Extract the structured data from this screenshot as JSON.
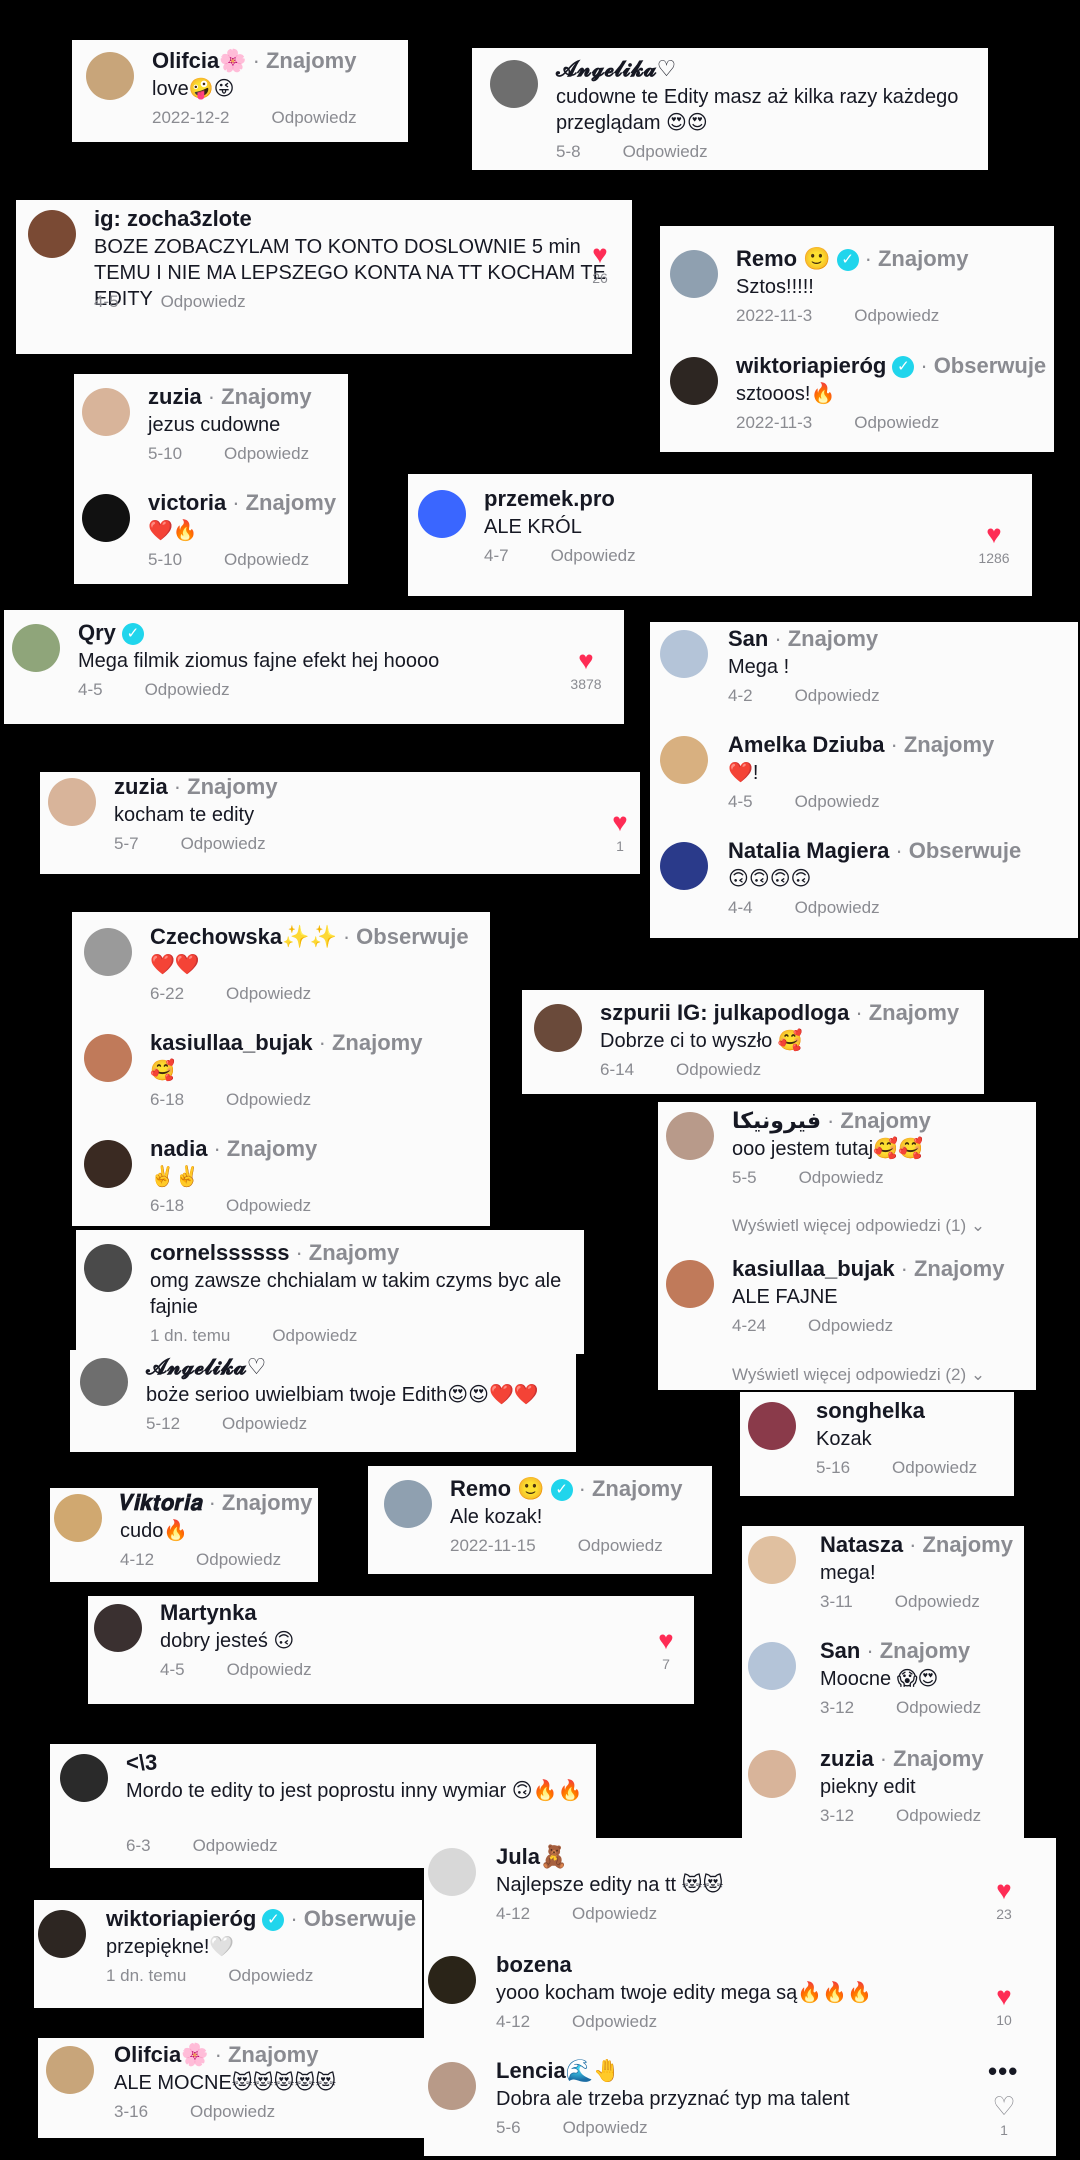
{
  "comments": [
    {
      "id": "c1",
      "user": "Olifcia🌸",
      "rel": "Znajomy",
      "text": "love🤪😜",
      "date": "2022-12-2",
      "reply": "Odpowiedz",
      "av": "#c8a57a"
    },
    {
      "id": "c2",
      "user": "𝓐𝓷𝓰𝓮𝓵𝓲𝓴𝓪♡",
      "rel": "",
      "text": "cudowne te Edity masz aż kilka razy każdego przeglądam 😍😍",
      "date": "5-8",
      "reply": "Odpowiedz",
      "av": "#6e6e6e"
    },
    {
      "id": "c3",
      "user": "ig:  zocha3zlote",
      "rel": "",
      "text": "BOZE ZOBACZYLAM TO KONTO DOSLOWNIE 5 min TEMU I NIE MA LEPSZEGO KONTA NA TT KOCHAM TE EDITY",
      "date": "4-5",
      "reply": "Odpowiedz",
      "av": "#7a4a34",
      "likes": "26"
    },
    {
      "id": "c4",
      "user": "Remo 🙂",
      "rel": "Znajomy",
      "verified": true,
      "text": "Sztos!!!!!",
      "date": "2022-11-3",
      "reply": "Odpowiedz",
      "av": "#8fa0b0"
    },
    {
      "id": "c5",
      "user": "wiktoriapieróg",
      "rel": "Obserwuje",
      "verified": true,
      "text": "sztooos!🔥",
      "date": "2022-11-3",
      "reply": "Odpowiedz",
      "av": "#2d2622"
    },
    {
      "id": "c6",
      "user": "zuzia",
      "rel": "Znajomy",
      "text": "jezus cudowne",
      "date": "5-10",
      "reply": "Odpowiedz",
      "av": "#d8b49a"
    },
    {
      "id": "c7",
      "user": "victoria",
      "rel": "Znajomy",
      "text": "❤️🔥",
      "date": "5-10",
      "reply": "Odpowiedz",
      "av": "#111111"
    },
    {
      "id": "c8",
      "user": "przemek.pro",
      "rel": "",
      "text": "ALE KRÓL",
      "date": "4-7",
      "reply": "Odpowiedz",
      "av": "#3a66ff",
      "likes": "1286"
    },
    {
      "id": "c9",
      "user": "Qry",
      "rel": "",
      "verified": true,
      "text": "Mega filmik ziomus fajne efekt hej hoooo",
      "date": "4-5",
      "reply": "Odpowiedz",
      "av": "#8fa57a",
      "likes": "3878"
    },
    {
      "id": "c10",
      "user": "San",
      "rel": "Znajomy",
      "text": "Mega !",
      "date": "4-2",
      "reply": "Odpowiedz",
      "av": "#b4c4d8"
    },
    {
      "id": "c11",
      "user": "Amelka Dziuba",
      "rel": "Znajomy",
      "text": "❤️!",
      "date": "4-5",
      "reply": "Odpowiedz",
      "av": "#d8b080"
    },
    {
      "id": "c12",
      "user": "Natalia Magiera",
      "rel": "Obserwuje",
      "text": "🙃🙃🙃🙃",
      "date": "4-4",
      "reply": "Odpowiedz",
      "av": "#2a3a8a"
    },
    {
      "id": "c13",
      "user": "zuzia",
      "rel": "Znajomy",
      "text": "kocham te edity",
      "date": "5-7",
      "reply": "Odpowiedz",
      "av": "#d8b49a",
      "likes": "1"
    },
    {
      "id": "c14",
      "user": "Czechowska✨✨",
      "rel": "Obserwuje",
      "text": "❤️❤️",
      "date": "6-22",
      "reply": "Odpowiedz",
      "av": "#9a9a9a"
    },
    {
      "id": "c15",
      "user": "kasiullaa_bujak",
      "rel": "Znajomy",
      "text": "🥰",
      "date": "6-18",
      "reply": "Odpowiedz",
      "av": "#c07a5a"
    },
    {
      "id": "c16",
      "user": "nadia",
      "rel": "Znajomy",
      "text": "✌️✌️",
      "date": "6-18",
      "reply": "Odpowiedz",
      "av": "#3a2a22"
    },
    {
      "id": "c17",
      "user": "szpurii IG: julkapodloga",
      "rel": "Znajomy",
      "text": "Dobrze ci to wyszło 🥰",
      "date": "6-14",
      "reply": "Odpowiedz",
      "av": "#6a4a3a"
    },
    {
      "id": "c18",
      "user": "فيرونيكا",
      "rel": "Znajomy",
      "text": "ooo jestem tutaj🥰🥰",
      "date": "5-5",
      "reply": "Odpowiedz",
      "av": "#b89a8a"
    },
    {
      "id": "c19",
      "user": "kasiullaa_bujak",
      "rel": "Znajomy",
      "text": "ALE FAJNE",
      "date": "4-24",
      "reply": "Odpowiedz",
      "av": "#c07a5a"
    },
    {
      "id": "c20",
      "user": "cornelssssss",
      "rel": "Znajomy",
      "text": "omg zawsze chchialam w takim czyms byc ale fajnie",
      "date": "1 dn. temu",
      "reply": "Odpowiedz",
      "av": "#4a4a4a"
    },
    {
      "id": "c21",
      "user": "𝓐𝓷𝓰𝓮𝓵𝓲𝓴𝓪♡",
      "rel": "",
      "text": "boże serioo uwielbiam twoje Edith😍😍❤️❤️",
      "date": "5-12",
      "reply": "Odpowiedz",
      "av": "#6e6e6e"
    },
    {
      "id": "c22",
      "user": "songhelka",
      "rel": "",
      "text": "Kozak",
      "date": "5-16",
      "reply": "Odpowiedz",
      "av": "#8a3a4a"
    },
    {
      "id": "c23",
      "user": "𝑽𝒊𝒌𝒕𝒐𝒓𝒊𝒂",
      "rel": "Znajomy",
      "text": "cudo🔥",
      "date": "4-12",
      "reply": "Odpowiedz",
      "av": "#d0a870"
    },
    {
      "id": "c24",
      "user": "Remo 🙂",
      "rel": "Znajomy",
      "verified": true,
      "text": "Ale kozak!",
      "date": "2022-11-15",
      "reply": "Odpowiedz",
      "av": "#8fa0b0"
    },
    {
      "id": "c25",
      "user": "Natasza",
      "rel": "Znajomy",
      "text": "mega!",
      "date": "3-11",
      "reply": "Odpowiedz",
      "av": "#e0c0a0"
    },
    {
      "id": "c26",
      "user": "Martynka",
      "rel": "",
      "text": "dobry jesteś 🙃",
      "date": "4-5",
      "reply": "Odpowiedz",
      "av": "#3a3030",
      "likes": "7"
    },
    {
      "id": "c27",
      "user": "San",
      "rel": "Znajomy",
      "text": "Moocne 😱😍",
      "date": "3-12",
      "reply": "Odpowiedz",
      "av": "#b4c4d8"
    },
    {
      "id": "c28",
      "user": "zuzia",
      "rel": "Znajomy",
      "text": "piekny edit",
      "date": "3-12",
      "reply": "Odpowiedz",
      "av": "#d8b49a"
    },
    {
      "id": "c29",
      "user": "<\\3",
      "rel": "",
      "text": "Mordo te edity to jest poprostu inny wymiar 🙃🔥🔥",
      "date": "6-3",
      "reply": "Odpowiedz",
      "av": "#2a2a2a"
    },
    {
      "id": "c30",
      "user": "Jula🧸",
      "rel": "",
      "text": "Najlepsze edity na tt 😻😻",
      "date": "4-12",
      "reply": "Odpowiedz",
      "av": "#d8d8d8",
      "likes": "23"
    },
    {
      "id": "c31",
      "user": "wiktoriapieróg",
      "rel": "Obserwuje",
      "verified": true,
      "text": "przepiękne!🤍",
      "date": "1 dn. temu",
      "reply": "Odpowiedz",
      "av": "#2d2622"
    },
    {
      "id": "c32",
      "user": "bozena",
      "rel": "",
      "text": "yooo kocham twoje edity mega są🔥🔥🔥",
      "date": "4-12",
      "reply": "Odpowiedz",
      "av": "#2a2418",
      "likes": "10"
    },
    {
      "id": "c33",
      "user": "Olifcia🌸",
      "rel": "Znajomy",
      "text": "ALE MOCNE😻😻😻😻😻",
      "date": "3-16",
      "reply": "Odpowiedz",
      "av": "#c8a57a"
    },
    {
      "id": "c34",
      "user": "Lencia🌊🤚",
      "rel": "",
      "text": "Dobra ale trzeba przyznać typ ma talent",
      "date": "5-6",
      "reply": "Odpowiedz",
      "av": "#b89a88",
      "likes": "1",
      "empty": true
    }
  ],
  "more_replies_1": "Wyświetl więcej odpowiedzi (1) ⌄",
  "more_replies_2": "Wyświetl więcej odpowiedzi (2) ⌄",
  "options_glyph": "•••",
  "heart_glyph": "♥",
  "heart_empty_glyph": "♡",
  "verified_glyph": "✓",
  "separator": "·"
}
